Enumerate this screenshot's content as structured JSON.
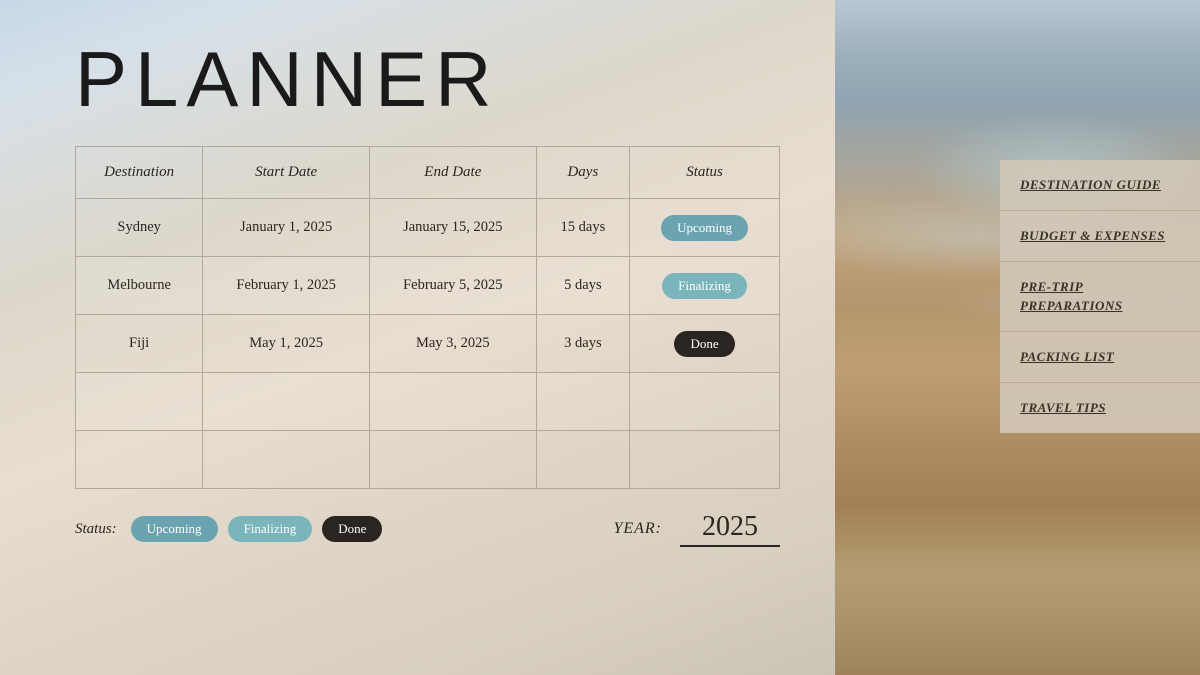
{
  "page": {
    "title": "PLANNER"
  },
  "table": {
    "headers": [
      "Destination",
      "Start Date",
      "End Date",
      "Days",
      "Status"
    ],
    "rows": [
      {
        "destination": "Sydney",
        "start_date": "January 1, 2025",
        "end_date": "January 15, 2025",
        "days": "15 days",
        "status": "Upcoming",
        "status_type": "upcoming"
      },
      {
        "destination": "Melbourne",
        "start_date": "February 1, 2025",
        "end_date": "February 5, 2025",
        "days": "5 days",
        "status": "Finalizing",
        "status_type": "finalizing"
      },
      {
        "destination": "Fiji",
        "start_date": "May 1, 2025",
        "end_date": "May 3, 2025",
        "days": "3 days",
        "status": "Done",
        "status_type": "done"
      },
      {
        "destination": "",
        "start_date": "",
        "end_date": "",
        "days": "",
        "status": "",
        "status_type": ""
      },
      {
        "destination": "",
        "start_date": "",
        "end_date": "",
        "days": "",
        "status": "",
        "status_type": ""
      }
    ]
  },
  "footer": {
    "status_label": "Status:",
    "badges": [
      "Upcoming",
      "Finalizing",
      "Done"
    ],
    "year_label": "YEAR:",
    "year_value": "2025"
  },
  "sidebar": {
    "items": [
      {
        "label": "DESTINATION GUIDE"
      },
      {
        "label": "BUDGET & EXPENSES"
      },
      {
        "label": "PRE-TRIP PREPARATIONS"
      },
      {
        "label": "PACKING LIST"
      },
      {
        "label": "TRAVEL TIPS"
      }
    ]
  }
}
